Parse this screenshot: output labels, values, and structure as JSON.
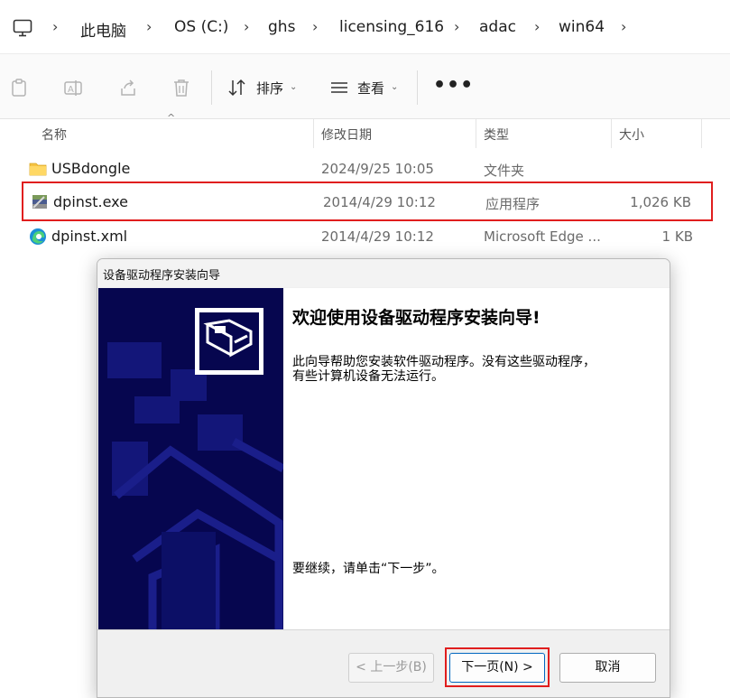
{
  "address_bar": {
    "crumbs": [
      "此电脑",
      "OS (C:)",
      "ghs",
      "licensing_616",
      "adac",
      "win64"
    ]
  },
  "toolbar": {
    "sort_label": "排序",
    "view_label": "查看",
    "more_label": "•••"
  },
  "file_list": {
    "columns": [
      "名称",
      "修改日期",
      "类型",
      "大小"
    ],
    "rows": [
      {
        "name": "USBdongle",
        "date": "2024/9/25 10:05",
        "type": "文件夹",
        "size": "",
        "icon": "folder-icon"
      },
      {
        "name": "dpinst.exe",
        "date": "2014/4/29 10:12",
        "type": "应用程序",
        "size": "1,026 KB",
        "icon": "installer-icon"
      },
      {
        "name": "dpinst.xml",
        "date": "2014/4/29 10:12",
        "type": "Microsoft Edge ...",
        "size": "1 KB",
        "icon": "edge-icon"
      }
    ]
  },
  "dialog": {
    "title": "设备驱动程序安装向导",
    "heading": "欢迎使用设备驱动程序安装向导!",
    "description": "此向导帮助您安装软件驱动程序。没有这些驱动程序，有些计算机设备无法运行。",
    "continue_text": "要继续，请单击“下一步”。",
    "back_button": "< 上一步(B)",
    "next_button": "下一页(N) >",
    "cancel_button": "取消"
  },
  "colors": {
    "highlight_red": "#e01e1e",
    "wizard_banner": "#06064f",
    "folder_yellow": "#f6c343"
  }
}
